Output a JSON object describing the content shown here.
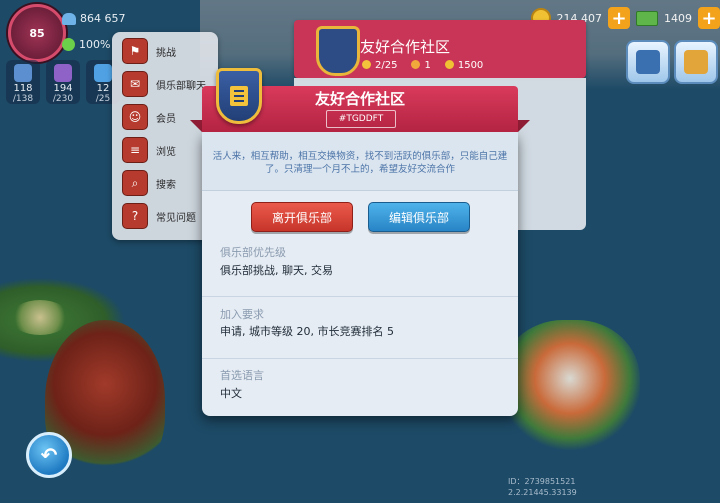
{
  "hud": {
    "level": "85",
    "population": "864 657",
    "happiness": "100%",
    "stats": [
      {
        "v1": "118",
        "v2": "/138",
        "color": "#5b8fcf"
      },
      {
        "v1": "194",
        "v2": "/230",
        "color": "#8f62c8"
      },
      {
        "v1": "12",
        "v2": "/25",
        "color": "#4fa1e3"
      }
    ],
    "simoleons": "214 407",
    "simcash": "1409"
  },
  "side_menu": [
    {
      "label": "挑战",
      "icon": "⚑"
    },
    {
      "label": "俱乐部聊天",
      "icon": "✉"
    },
    {
      "label": "会员",
      "icon": "☺"
    },
    {
      "label": "浏览",
      "icon": "≡"
    },
    {
      "label": "搜索",
      "icon": "⌕"
    },
    {
      "label": "常见问题",
      "icon": "?"
    }
  ],
  "bg_club": {
    "name": "友好合作社区",
    "members": "2/25",
    "trophies": "1",
    "points": "1500"
  },
  "dialog": {
    "title": "友好合作社区",
    "tag": "#TGDDFT",
    "description": "活人来，相互帮助，相互交换物资，找不到活跃的俱乐部，只能自己建了。只清理一个月不上的，希望友好交流合作",
    "leave_label": "离开俱乐部",
    "edit_label": "编辑俱乐部",
    "priority_label": "俱乐部优先级",
    "priority_value": "俱乐部挑战, 聊天, 交易",
    "requirements_label": "加入要求",
    "requirements_value": "申请, 城市等级 20, 市长竞赛排名 5",
    "language_label": "首选语言",
    "language_value": "中文"
  },
  "footer": {
    "id": "ID：2739851521",
    "version": "2.2.21445.33139"
  }
}
